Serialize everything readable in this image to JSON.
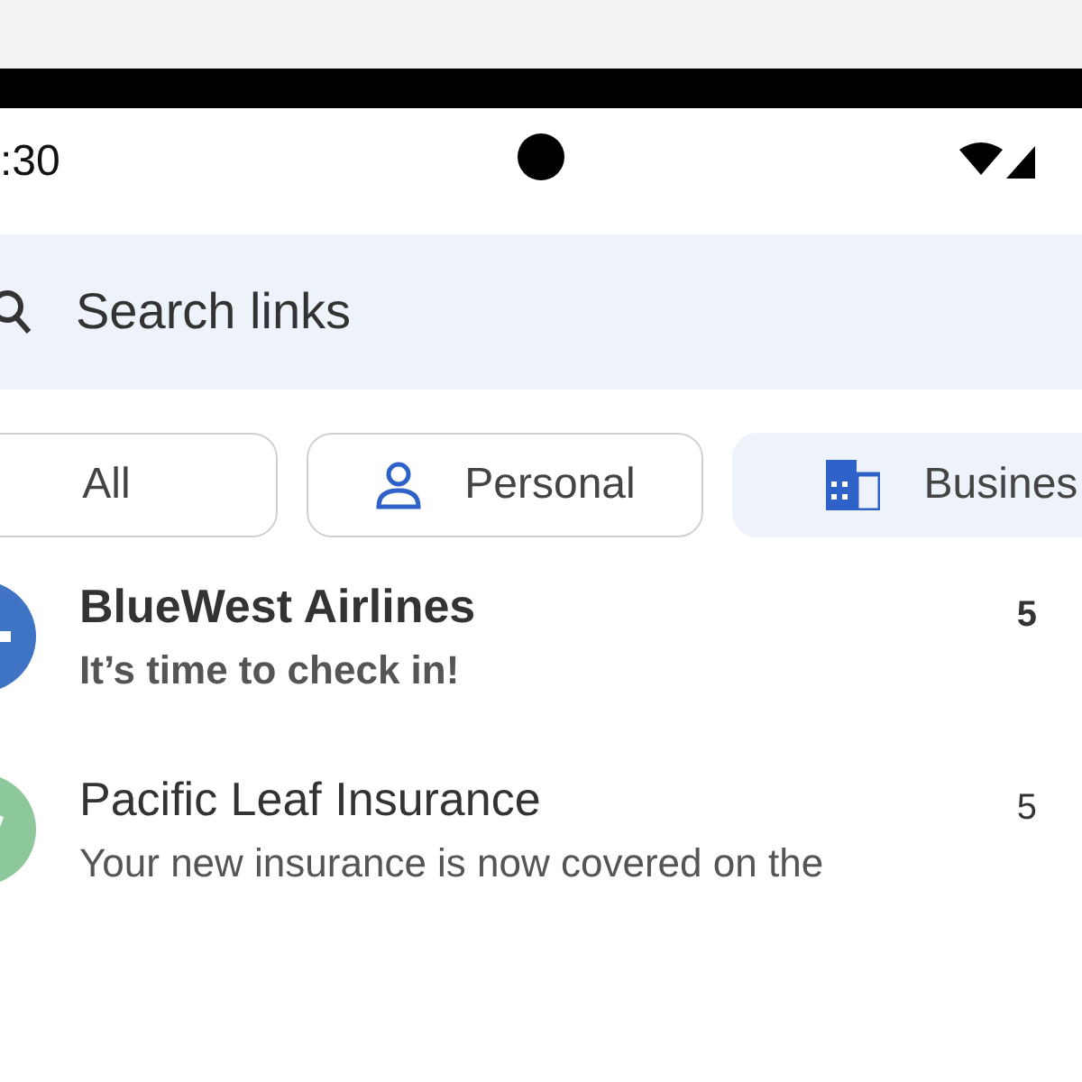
{
  "status_bar": {
    "time": ":30"
  },
  "search": {
    "placeholder": "Search links"
  },
  "filters": [
    {
      "label": "All",
      "kind": "plain",
      "selected": false
    },
    {
      "label": "Personal",
      "kind": "person",
      "selected": false
    },
    {
      "label": "Busines",
      "kind": "building",
      "selected": true
    }
  ],
  "messages": [
    {
      "sender": "BlueWest Airlines",
      "preview": "It’s time to check in!",
      "time": "5",
      "unread": true,
      "color": "#3f74c4"
    },
    {
      "sender": "Pacific Leaf Insurance",
      "preview": "Your new insurance is now covered on the",
      "time": "5",
      "unread": false,
      "color": "#8dc89b"
    }
  ]
}
